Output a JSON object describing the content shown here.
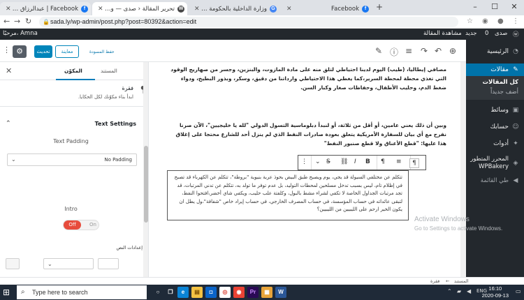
{
  "browser": {
    "tabs": [
      {
        "title": "Facebook | عبدالرزاق الداهش",
        "icon": "f"
      },
      {
        "title": "تحرير المقالة ‹ صدى — ووردبريس",
        "icon": "W"
      },
      {
        "title": "وزارة الداخلية بالحكومة الليبية المؤقتة",
        "icon": "G"
      },
      {
        "title": "Facebook",
        "icon": "f"
      }
    ],
    "new_tab": "+",
    "url": "sada.ly/wp-admin/post.php?post=80392&action=edit"
  },
  "admin_bar": {
    "site": "صدى",
    "comments": "0",
    "new": "جديد",
    "view": "مشاهدة المقالة",
    "greeting": "مرحبًا، Amna"
  },
  "admin_menu": {
    "dashboard": "الرئيسية",
    "posts": "مقالات",
    "all_posts": "كل المقالات",
    "add_new": "أضف جديداً",
    "media": "وسائط",
    "accounts": "حسابك",
    "tools": "أدوات",
    "wpbakery_1": "المحرر المتطور",
    "wpbakery_2": "WPBakery",
    "collapse": "طي القائمة"
  },
  "toolbar": {
    "draft_link": "حفظ المسودة",
    "preview": "معاينة",
    "update": "تحديث",
    "gear": "⚙"
  },
  "sidebar": {
    "tab_document": "المستند",
    "tab_block": "المكوّن",
    "block_title": "فقرة",
    "block_desc": "ابدأ بناء مكوّنك لكل الحكايا.",
    "text_settings": "Text Settings",
    "text_padding": "Text Padding",
    "padding_value": "No Padding",
    "intro": "Intro",
    "toggle_off": "Off",
    "toggle_on": "On",
    "text_settings_ar": "إعدادات النص"
  },
  "content": {
    "para1": "مصافي إيطاليا، (طيب) اليوم لدينا احتياطي لتلق منه على مادة المازوت، والبنزين، وجسر من صهاريج الوقود التي تغذي محطة لمحطة السرير،كما يغطي هذا الاحتياطي وارداتنا من دقيق، وسكر، وبذور البطيخ، ودواء ضغط الدم، وحليب الأطفال، وحفاظات صغار وكبار السن.",
    "para2": "وبين أن ذلك يعني عامين، أو أقل من ثلاثة، أو لنبدأ دبلوماسية التسول الدولي \"لله يا خليجيين\"، الآن صرنا نفرح مع أي بيان للسفارة الأمريكية يتعلق بعودة صادرات النفط الذي لم ينزل أحد للشارع محتجا على إغلاق هذا عليها: \"قطع الأعناق ولا قطع صنبور النفط\"",
    "selected": "تتكلم عن مختلفي السيولة قد يجي، يوم ويصبح طبق البيض بحوذ عربة بنيوية \"بروطة\"، تتكلم عن الكهرباء قد تصبح في إظلام تام، ليس بسبب تدخل مسلحين لمحطات التوليد، بل عدم توفر ما تولد به، تتكلم عن تدني المرتبات، قد تجد مرتبات الجداول الخاصة لا تكفي لشراء مشط بالبول، وكلفتة علب حليب، ويكفي شاي أخضر،افتحوا النفط، لتبقى عائداته في حساب المؤسسة، في حساب المصرف الخارجي، في حساب إيراد خاص \"شفافة\"،ول يطل ان يكون الخير ارحم على الليبيين من الليبيين؟"
  },
  "breadcrumb": {
    "document": "المستند",
    "sep": "←",
    "block": "فقرة"
  },
  "watermark": {
    "line1": "Activate Windows",
    "line2": "Go to Settings to activate Windows."
  },
  "taskbar": {
    "search_placeholder": "Type here to search",
    "lang": "ENG",
    "time": "16:10",
    "date": "2020-09-13"
  },
  "colors": {
    "wp_blue": "#0073aa",
    "admin_dark": "#23282d",
    "toggle_off": "#e74c3c",
    "taskbar": "#1f2a38"
  }
}
